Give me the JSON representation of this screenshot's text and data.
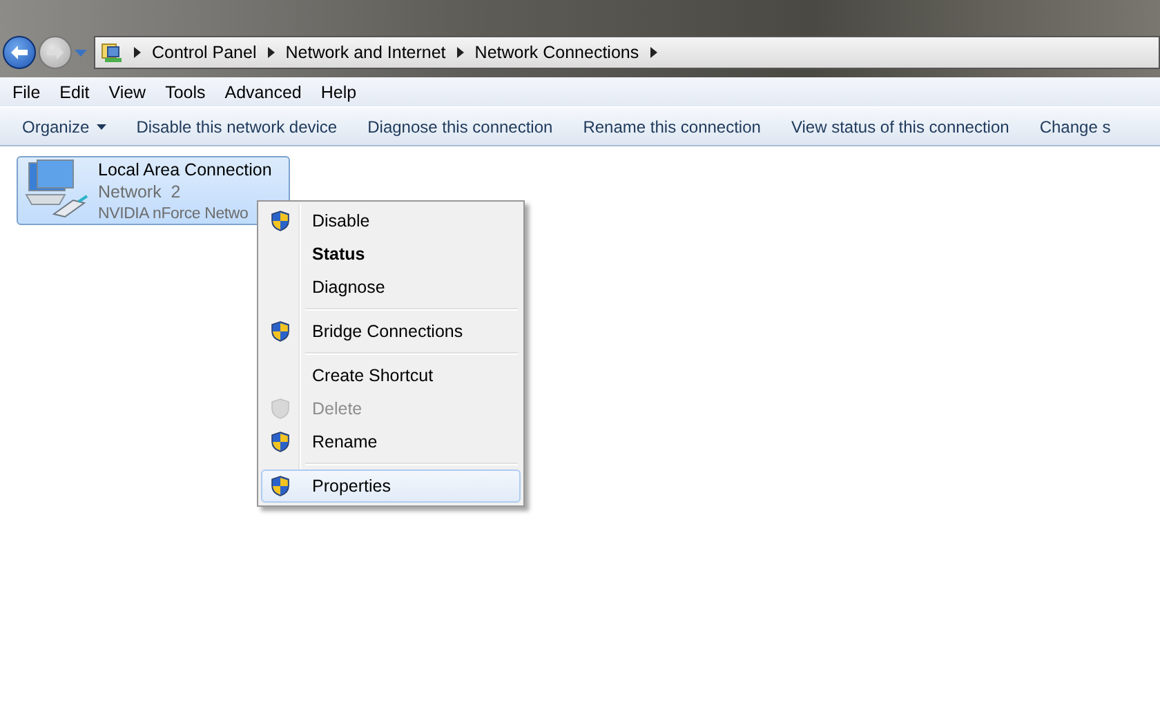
{
  "address_bar": {
    "path": [
      "Control Panel",
      "Network and Internet",
      "Network Connections"
    ]
  },
  "menu_bar": [
    "File",
    "Edit",
    "View",
    "Tools",
    "Advanced",
    "Help"
  ],
  "command_bar": [
    {
      "label": "Organize",
      "dropdown": true
    },
    {
      "label": "Disable this network device",
      "dropdown": false
    },
    {
      "label": "Diagnose this connection",
      "dropdown": false
    },
    {
      "label": "Rename this connection",
      "dropdown": false
    },
    {
      "label": "View status of this connection",
      "dropdown": false
    },
    {
      "label": "Change s",
      "dropdown": false
    }
  ],
  "connection": {
    "name": "Local Area Connection",
    "network": "Network  2",
    "adapter": "NVIDIA nForce Netwo",
    "selected": true
  },
  "context_menu": [
    [
      {
        "label": "Disable",
        "shield": true,
        "default": false,
        "disabled": false,
        "selected": false
      },
      {
        "label": "Status",
        "shield": false,
        "default": true,
        "disabled": false,
        "selected": false
      },
      {
        "label": "Diagnose",
        "shield": false,
        "default": false,
        "disabled": false,
        "selected": false
      }
    ],
    [
      {
        "label": "Bridge Connections",
        "shield": true,
        "default": false,
        "disabled": false,
        "selected": false
      }
    ],
    [
      {
        "label": "Create Shortcut",
        "shield": false,
        "default": false,
        "disabled": false,
        "selected": false
      },
      {
        "label": "Delete",
        "shield": true,
        "default": false,
        "disabled": true,
        "selected": false
      },
      {
        "label": "Rename",
        "shield": true,
        "default": false,
        "disabled": false,
        "selected": false
      }
    ],
    [
      {
        "label": "Properties",
        "shield": true,
        "default": false,
        "disabled": false,
        "selected": true
      }
    ]
  ]
}
